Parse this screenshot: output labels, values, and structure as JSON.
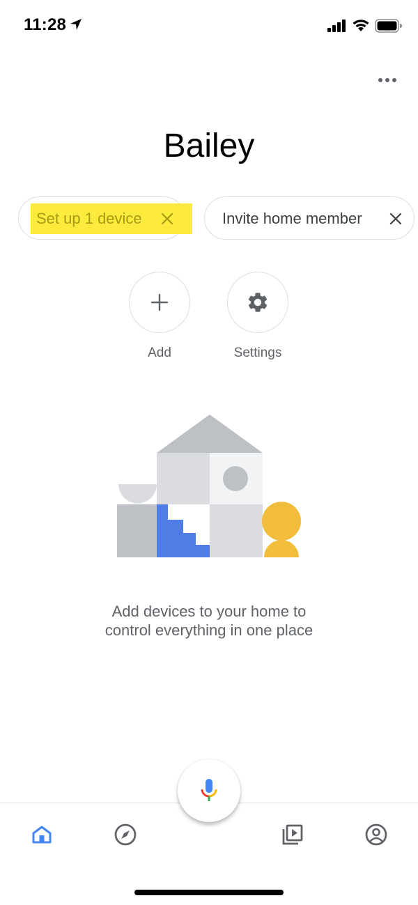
{
  "status_bar": {
    "time": "11:28",
    "icons": [
      "location-arrow-icon",
      "cellular-signal-icon",
      "wifi-icon",
      "battery-icon"
    ]
  },
  "header": {
    "more_icon": "more-horizontal-icon",
    "home_name": "Bailey"
  },
  "chips": [
    {
      "label": "Set up 1 device",
      "icon": "close-icon",
      "highlighted": true
    },
    {
      "label": "Invite home member",
      "icon": "close-icon",
      "highlighted": false
    }
  ],
  "actions": [
    {
      "label": "Add",
      "icon": "plus-icon"
    },
    {
      "label": "Settings",
      "icon": "gear-icon"
    }
  ],
  "empty_state": {
    "illustration": "house-illustration",
    "message": "Add devices to your home to control everything in one place"
  },
  "bottom_nav": {
    "items": [
      {
        "icon": "home-icon",
        "active": true
      },
      {
        "icon": "compass-icon",
        "active": false
      },
      {
        "icon": "media-icon",
        "active": false
      },
      {
        "icon": "account-icon",
        "active": false
      }
    ],
    "mic_icon": "microphone-icon"
  },
  "colors": {
    "accent_blue": "#4285f4",
    "highlight_yellow": "#fcea3c",
    "illustration_yellow": "#f2bd3c",
    "text_gray": "#5f6368",
    "icon_gray": "#5f6368"
  }
}
